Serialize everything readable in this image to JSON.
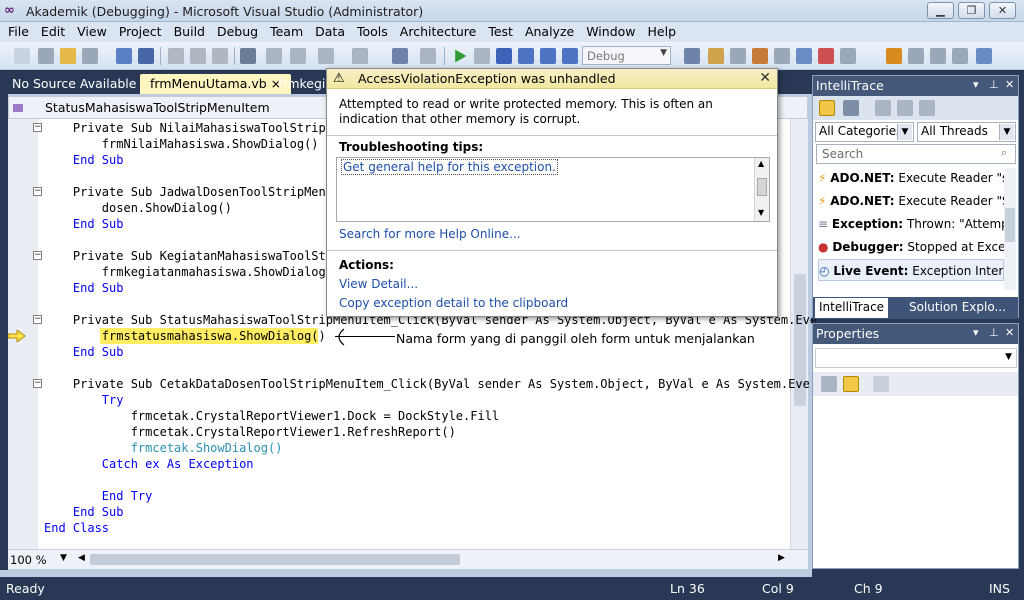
{
  "window": {
    "title": "Akademik (Debugging) - Microsoft Visual Studio (Administrator)",
    "controls": [
      "minimize",
      "restore",
      "close"
    ]
  },
  "menu": {
    "items": [
      "File",
      "Edit",
      "View",
      "Project",
      "Build",
      "Debug",
      "Team",
      "Data",
      "Tools",
      "Architecture",
      "Test",
      "Analyze",
      "Window",
      "Help"
    ]
  },
  "toolbar": {
    "configuration": "Debug"
  },
  "doc_tabs": {
    "items": [
      {
        "label": "No Source Available"
      },
      {
        "label": "frmMenuUtama.vb",
        "close": "×"
      },
      {
        "label": "frmkegiat"
      }
    ]
  },
  "nav_bar": {
    "member": "StatusMahasiswaToolStripMenuItem"
  },
  "code": {
    "lines": [
      "    Private Sub NilaiMahasiswaToolStripMe",
      "        frmNilaiMahasiswa.ShowDialog()",
      "    End Sub",
      "",
      "    Private Sub JadwalDosenToolStripMenuI",
      "        dosen.ShowDialog()",
      "    End Sub",
      "",
      "    Private Sub KegiatanMahasiswaToolStri",
      "        frmkegiatanmahasiswa.ShowDialog()",
      "    End Sub",
      "",
      "    Private Sub StatusMahasiswaToolStripMenuItem_Click(ByVal sender As System.Object, ByVal e As System.Eve",
      "        frmstatusmahasiswa.ShowDialog()",
      "    End Sub",
      "",
      "    Private Sub CetakDataDosenToolStripMenuItem_Click(ByVal sender As System.Object, ByVal e As System.Eve",
      "        Try",
      "            frmcetak.CrystalReportViewer1.Dock = DockStyle.Fill",
      "            frmcetak.CrystalReportViewer1.RefreshReport()",
      "            frmcetak.ShowDialog()",
      "        Catch ex As Exception",
      "",
      "        End Try",
      "    End Sub",
      "End Class"
    ],
    "annotation": "Nama form yang di panggil oleh form untuk menjalankan"
  },
  "editor_footer": {
    "zoom": "100 %"
  },
  "exception_dialog": {
    "title": "AccessViolationException was unhandled",
    "message": "Attempted to read or write protected memory. This is often an indication that other memory is corrupt.",
    "tips_heading": "Troubleshooting tips:",
    "tip_link": "Get general help for this exception.",
    "search_link": "Search for more Help Online...",
    "actions_heading": "Actions:",
    "actions": [
      "View Detail...",
      "Copy exception detail to the clipboard"
    ]
  },
  "intellitrace": {
    "title": "IntelliTrace",
    "category_filter": "All Categories",
    "thread_filter": "All Threads",
    "search_placeholder": "Search",
    "events": [
      {
        "kind": "ADO.NET:",
        "text": "Execute Reader \"sel"
      },
      {
        "kind": "ADO.NET:",
        "text": "Execute Reader \"SEL"
      },
      {
        "kind": "Exception:",
        "text": "Thrown: \"Attempt"
      },
      {
        "kind": "Debugger:",
        "text": "Stopped at Excepti"
      },
      {
        "kind": "Live Event:",
        "text": "Exception Intercep"
      }
    ],
    "tabs": [
      "IntelliTrace",
      "Solution Explo..."
    ]
  },
  "properties": {
    "title": "Properties"
  },
  "status_bar": {
    "state": "Ready",
    "line": "Ln 36",
    "col": "Col 9",
    "ch": "Ch 9",
    "mode": "INS"
  },
  "colors": {
    "chrome_dark": "#293955",
    "keyword": "#0000ff",
    "type": "#2b91af",
    "highlight": "#ffee62",
    "link": "#1f4fa8"
  }
}
